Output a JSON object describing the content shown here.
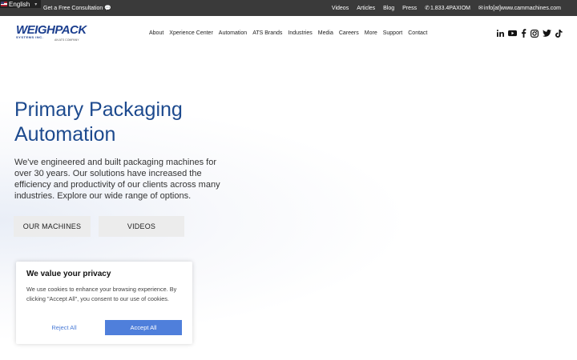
{
  "topbar": {
    "language": "English",
    "consultation": "Get a Free Consultation",
    "links": [
      "Videos",
      "Articles",
      "Blog",
      "Press"
    ],
    "phone": "1.833.4PAXIOM",
    "email": "info[at]www.cammachines.com"
  },
  "logo": {
    "main": "WEIGHPACK",
    "sub": "SYSTEMS INC.",
    "tagline": "AN ATS COMPANY"
  },
  "nav": {
    "items": [
      "About",
      "Xperience Center",
      "Automation",
      "ATS Brands",
      "Industries",
      "Media",
      "Careers",
      "More",
      "Support",
      "Contact"
    ]
  },
  "social": [
    "linkedin-icon",
    "youtube-icon",
    "facebook-icon",
    "instagram-icon",
    "twitter-icon",
    "tiktok-icon"
  ],
  "hero": {
    "title": "Primary Packaging Automation",
    "description": "We've engineered and built packaging machines for over 30 years. Our solutions have increased the efficiency and productivity of our clients across many industries. Explore our wide range of options.",
    "btn_machines": "OUR MACHINES",
    "btn_videos": "VIDEOS"
  },
  "cookie": {
    "title": "We value your privacy",
    "text": "We use cookies to enhance your browsing experience. By clicking \"Accept All\", you consent to our use of cookies.",
    "reject": "Reject All",
    "accept": "Accept All"
  },
  "colors": {
    "brand_blue": "#1d4a8e",
    "topbar_bg": "#3a3a3a",
    "accept_blue": "#4f7fdb"
  }
}
